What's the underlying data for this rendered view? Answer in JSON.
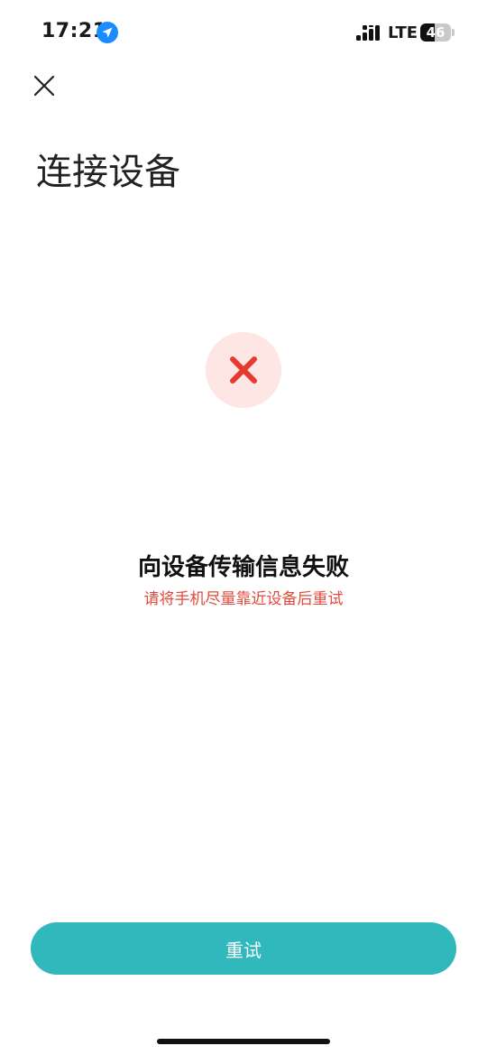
{
  "status_bar": {
    "time": "17:21",
    "network": "LTE",
    "battery_level": "46",
    "battery_fraction": 0.46,
    "icons": [
      "location-arrow-icon",
      "signal-icon",
      "battery-icon"
    ]
  },
  "header": {
    "close_icon": "close-icon",
    "title": "连接设备"
  },
  "result": {
    "icon": "error-x-icon",
    "title": "向设备传输信息失败",
    "hint": "请将手机尽量靠近设备后重试"
  },
  "footer": {
    "retry_label": "重试"
  },
  "colors": {
    "accent": "#31b8bd",
    "error": "#e24a3b",
    "error_bg": "#fde6e4",
    "location_blue": "#1a8cff"
  }
}
